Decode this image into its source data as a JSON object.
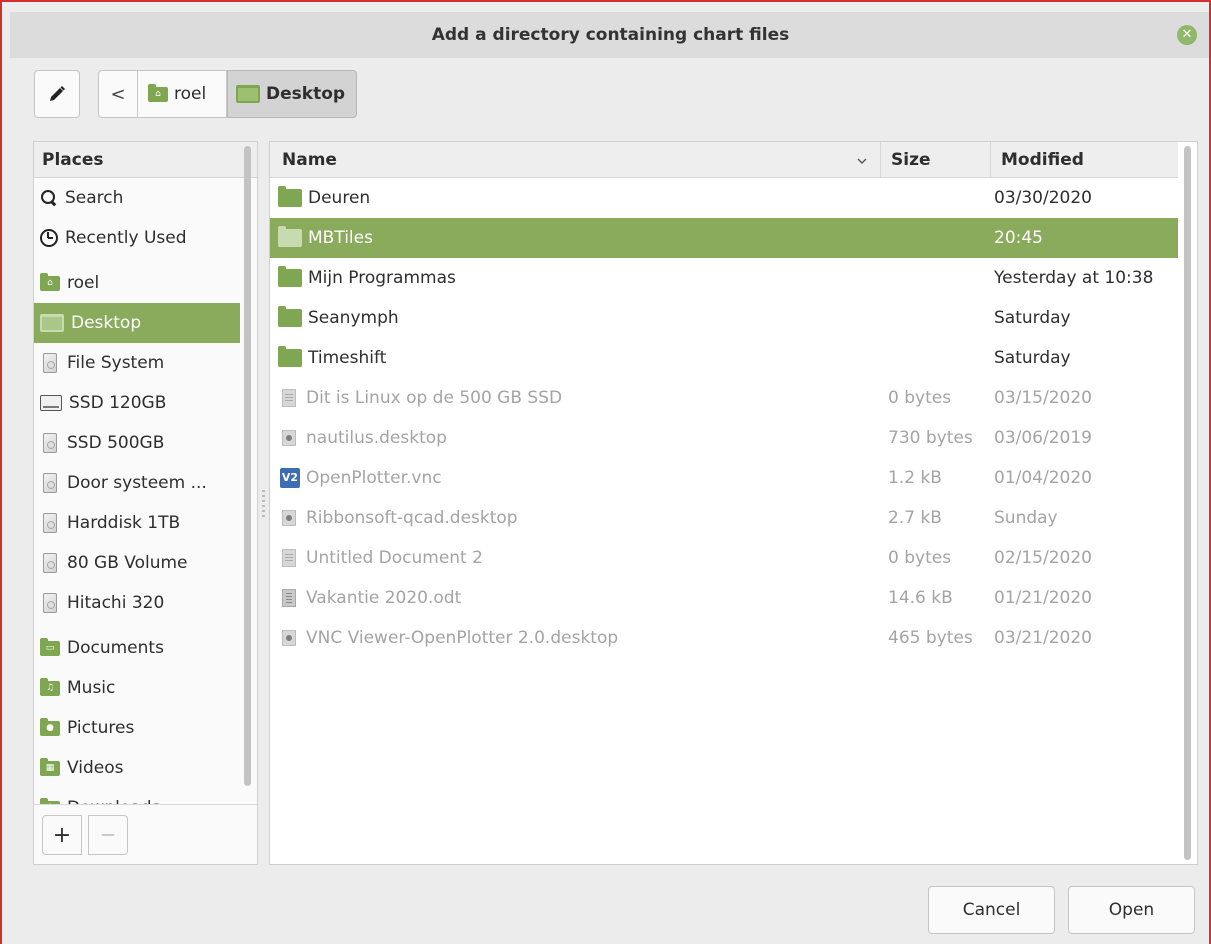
{
  "window": {
    "title": "Add a directory containing chart files",
    "close_symbol": "✕"
  },
  "pathbar": {
    "edit_icon": "pencil-icon",
    "back_symbol": "<",
    "crumbs": [
      "roel",
      "Desktop"
    ]
  },
  "places": {
    "header": "Places",
    "items": [
      {
        "label": "Search",
        "icon": "search-icon"
      },
      {
        "label": "Recently Used",
        "icon": "clock-icon"
      },
      {
        "label": "roel",
        "icon": "home-folder-icon"
      },
      {
        "label": "Desktop",
        "icon": "desktop-icon",
        "selected": true
      },
      {
        "label": "File System",
        "icon": "drive-icon"
      },
      {
        "label": "SSD 120GB",
        "icon": "ssd-icon"
      },
      {
        "label": "SSD 500GB",
        "icon": "drive-icon"
      },
      {
        "label": "Door systeem ...",
        "icon": "drive-icon"
      },
      {
        "label": "Harddisk 1TB",
        "icon": "drive-icon"
      },
      {
        "label": "80 GB Volume",
        "icon": "drive-icon"
      },
      {
        "label": "Hitachi 320",
        "icon": "drive-icon"
      },
      {
        "label": "Documents",
        "icon": "documents-folder-icon"
      },
      {
        "label": "Music",
        "icon": "music-folder-icon"
      },
      {
        "label": "Pictures",
        "icon": "pictures-folder-icon"
      },
      {
        "label": "Videos",
        "icon": "videos-folder-icon"
      },
      {
        "label": "Downloads",
        "icon": "downloads-folder-icon"
      }
    ],
    "add_symbol": "+",
    "remove_symbol": "—"
  },
  "files": {
    "columns": {
      "name": "Name",
      "size": "Size",
      "modified": "Modified"
    },
    "rows": [
      {
        "name": "Deuren",
        "size": "",
        "modified": "03/30/2020",
        "icon": "folder-icon"
      },
      {
        "name": "MBTiles",
        "size": "",
        "modified": "20:45",
        "icon": "folder-icon",
        "selected": true
      },
      {
        "name": "Mijn Programmas",
        "size": "",
        "modified": "Yesterday at 10:38",
        "icon": "folder-icon"
      },
      {
        "name": "Seanymph",
        "size": "",
        "modified": "Saturday",
        "icon": "folder-icon"
      },
      {
        "name": "Timeshift",
        "size": "",
        "modified": "Saturday",
        "icon": "folder-icon"
      },
      {
        "name": "Dit is Linux op de 500 GB SSD",
        "size": "0 bytes",
        "modified": "03/15/2020",
        "icon": "text-file-icon"
      },
      {
        "name": "nautilus.desktop",
        "size": "730 bytes",
        "modified": "03/06/2019",
        "icon": "desktop-file-icon"
      },
      {
        "name": "OpenPlotter.vnc",
        "size": "1.2 kB",
        "modified": "01/04/2020",
        "icon": "vnc-file-icon"
      },
      {
        "name": "Ribbonsoft-qcad.desktop",
        "size": "2.7 kB",
        "modified": "Sunday",
        "icon": "desktop-file-icon"
      },
      {
        "name": "Untitled Document 2",
        "size": "0 bytes",
        "modified": "02/15/2020",
        "icon": "text-file-icon"
      },
      {
        "name": "Vakantie 2020.odt",
        "size": "14.6 kB",
        "modified": "01/21/2020",
        "icon": "odt-file-icon"
      },
      {
        "name": "VNC Viewer-OpenPlotter 2.0.desktop",
        "size": "465 bytes",
        "modified": "03/21/2020",
        "icon": "desktop-file-icon"
      }
    ]
  },
  "buttons": {
    "cancel": "Cancel",
    "open": "Open"
  },
  "colors": {
    "accent": "#8aaa5c",
    "folder": "#7fa650",
    "frame_border": "#d32f2f"
  }
}
